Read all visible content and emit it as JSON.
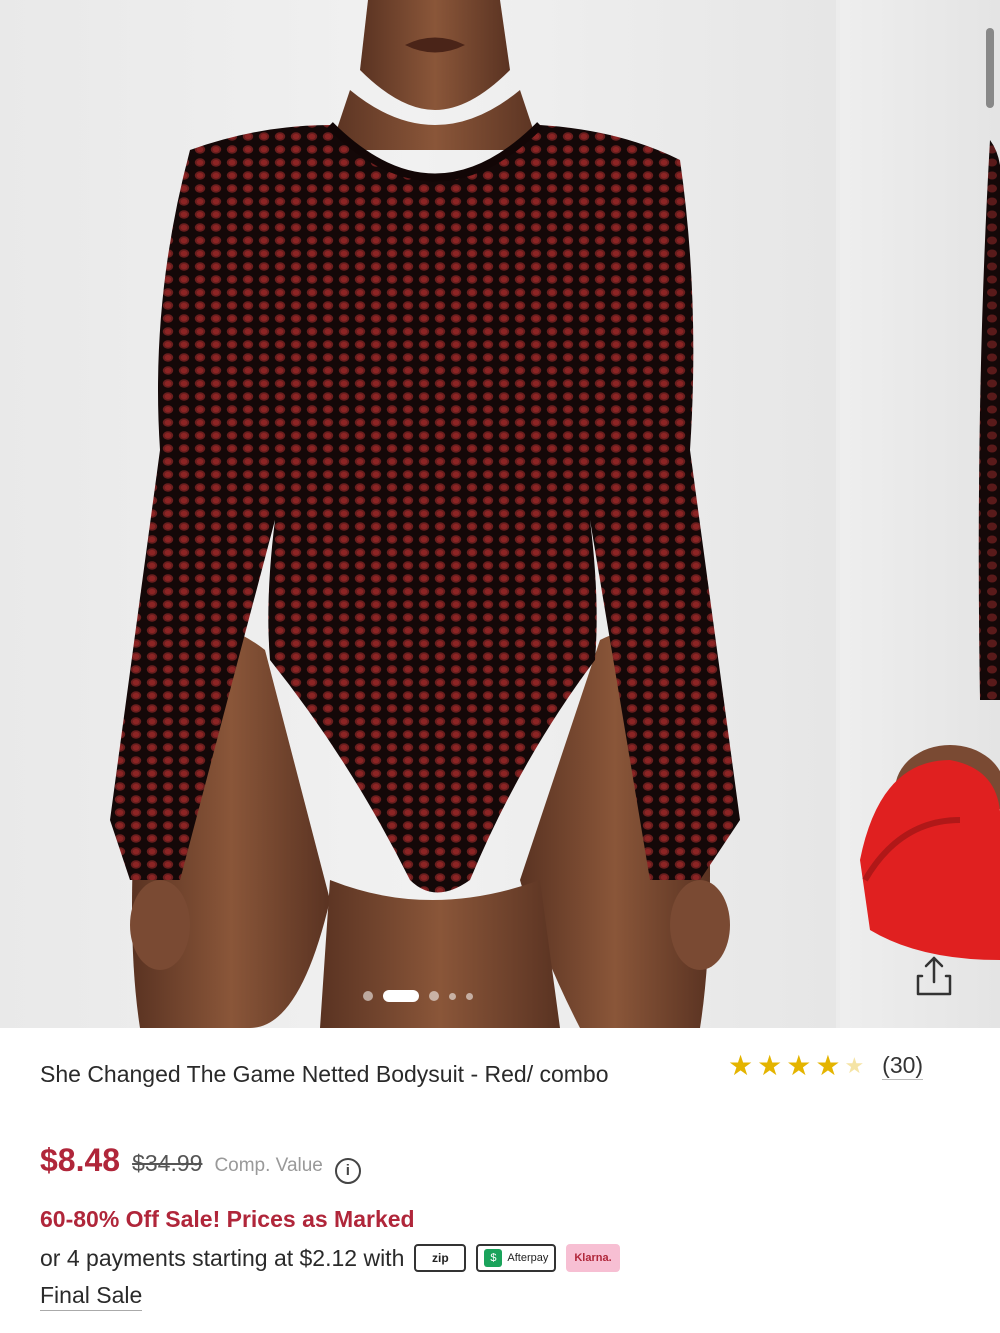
{
  "product": {
    "title": "She Changed The Game Netted Bodysuit - Red/ combo",
    "rating": {
      "stars": 4.5,
      "count_label": "(30)"
    },
    "price_sale": "$8.48",
    "price_original": "$34.99",
    "comp_value_label": "Comp. Value",
    "promo": "60-80% Off Sale! Prices as Marked",
    "payments_text": "or 4 payments starting at $2.12 with",
    "payment_providers": [
      "zip",
      "Afterpay",
      "Klarna."
    ],
    "final_sale": "Final Sale"
  },
  "carousel": {
    "slide_count": 5,
    "active_index": 1
  },
  "colors": {
    "sale_red": "#b0263a",
    "star_gold": "#e4b400"
  },
  "icons": [
    "share-icon",
    "info-icon",
    "star-icon"
  ]
}
